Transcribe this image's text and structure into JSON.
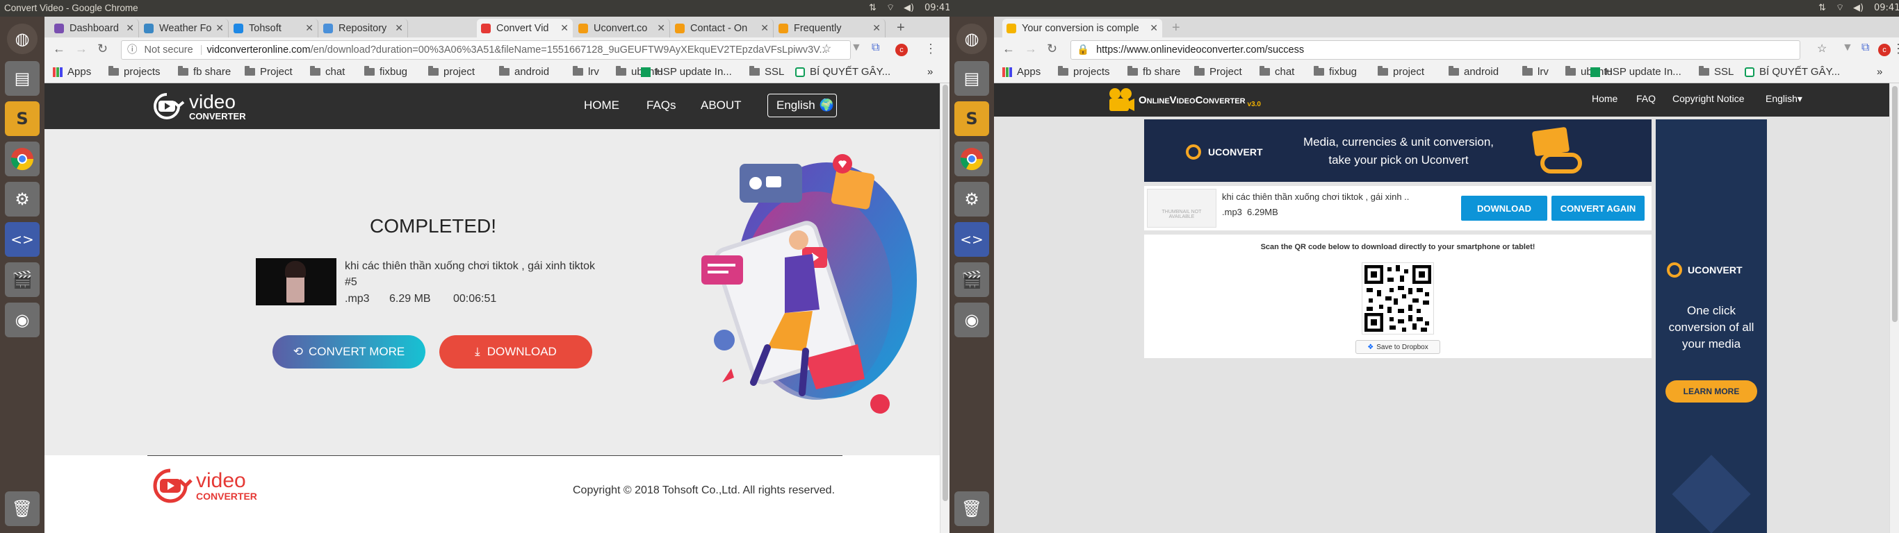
{
  "system": {
    "left_window_title": "Convert Video - Google Chrome",
    "right_window_title": "",
    "clock_left": "09:41",
    "clock_right": "09:41"
  },
  "left": {
    "tabs": [
      {
        "label": "Dashboard",
        "color": "#7a4fb0"
      },
      {
        "label": "Weather Fo",
        "color": "#3b88c4"
      },
      {
        "label": "Tohsoft",
        "color": "#1e88e5"
      },
      {
        "label": "Repository",
        "color": "#4a90d9"
      },
      {
        "label": "Convert Vid",
        "color": "#e53935"
      },
      {
        "label": "Uconvert.co",
        "color": "#f39c12"
      },
      {
        "label": "Contact - On",
        "color": "#f39c12"
      },
      {
        "label": "Frequently",
        "color": "#f39c12"
      }
    ],
    "url_security": "Not secure",
    "url_host": "vidconverteronline.com",
    "url_path": "/en/download?duration=00%3A06%3A51&fileName=1551667128_9uGEUFTW9AyXEkquEV2TEpzdaVFsLpiwv3V...",
    "bookmarks": [
      "Apps",
      "projects",
      "fb share",
      "Project",
      "chat",
      "fixbug",
      "project",
      "android",
      "lrv",
      "ubuntu",
      "HSP update In...",
      "SSL",
      "BÍ QUYẾT GÂY..."
    ],
    "site": {
      "logo_word1": "video",
      "logo_word2": "CONVERTER",
      "nav": [
        "HOME",
        "FAQs",
        "ABOUT"
      ],
      "language": "English",
      "heading": "COMPLETED!",
      "file_title": "khi các thiên thần xuống chơi tiktok , gái xinh tiktok #5",
      "file_format": ".mp3",
      "file_size": "6.29 MB",
      "file_duration": "00:06:51",
      "convert_more": "CONVERT MORE",
      "download": "DOWNLOAD",
      "copyright": "Copyright © 2018 Tohsoft Co.,Ltd. All rights reserved.",
      "footer_logo_word1": "video",
      "footer_logo_word2": "CONVERTER"
    }
  },
  "right": {
    "tab_label": "Your conversion is comple",
    "url": "https://www.onlinevideoconverter.com/success",
    "bookmarks": [
      "Apps",
      "projects",
      "fb share",
      "Project",
      "chat",
      "fixbug",
      "project",
      "android",
      "lrv",
      "ubuntu",
      "HSP update In...",
      "SSL",
      "BÍ QUYẾT GÂY..."
    ],
    "site": {
      "logo_main": "OnlineVideoConverter",
      "logo_version": "v3.0",
      "nav": [
        "Home",
        "FAQ",
        "Copyright Notice",
        "English"
      ],
      "banner_brand": "UCONVERT",
      "banner_line1": "Media, currencies & unit conversion,",
      "banner_line2": "take your pick on Uconvert",
      "thumb_text": "THUMBNAIL NOT AVAILABLE",
      "file_title": "khi các thiên thần xuống chơi tiktok , gái xinh ..",
      "file_format": ".mp3",
      "file_size": "6.29MB",
      "download": "DOWNLOAD",
      "convert_again": "CONVERT AGAIN",
      "qr_text": "Scan the QR code below to download directly to your smartphone or tablet!",
      "dropbox": "Save to Dropbox",
      "ad_brand": "UCONVERT",
      "ad_text": "One click conversion of all your media",
      "ad_button": "LEARN MORE"
    }
  }
}
